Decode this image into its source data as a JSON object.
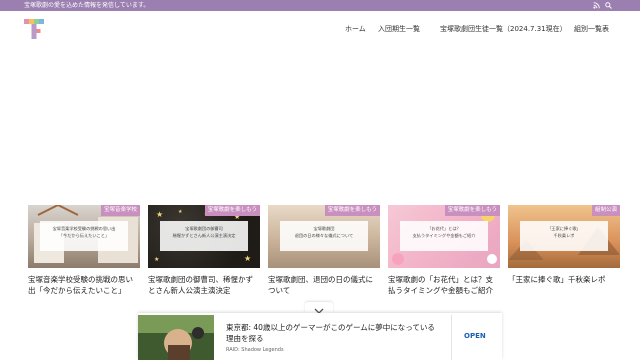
{
  "topbar": {
    "tagline": "宝塚歌劇の愛を込めた情報を発信しています。",
    "icons": [
      "rss-icon",
      "search-icon"
    ]
  },
  "header": {
    "nav": [
      {
        "label": "ホーム"
      },
      {
        "label": "入団期生一覧"
      },
      {
        "label": "宝塚歌劇団生徒一覧（2024.7.31現在）"
      },
      {
        "label": "組別一覧表"
      }
    ]
  },
  "cards": [
    {
      "badge": "宝塚音楽学校",
      "badge_color": "#c98fbf",
      "thumb_text": "宝塚音楽学校受験の挑戦の思い出\n「今だから伝えたいこと」",
      "title": "宝塚音楽学校受験の挑戦の思い出「今だから伝えたいこと」"
    },
    {
      "badge": "宝塚歌劇を楽しもう",
      "badge_color": "#c98fbf",
      "thumb_text": "宝塚歌劇団の御曹司\n稀惺かずとさん新人公演主演決定",
      "title": "宝塚歌劇団の御曹司、稀惺かずとさん新人公演主演決定"
    },
    {
      "badge": "宝塚歌劇を楽しもう",
      "badge_color": "#c98fbf",
      "thumb_text": "宝塚歌劇団\n退団の日の様々な儀式について",
      "title": "宝塚歌劇団、退団の日の儀式について"
    },
    {
      "badge": "宝塚歌劇を楽しもう",
      "badge_color": "#c98fbf",
      "thumb_text": "「お花代」とは？\n支払うタイミングや金額もご紹介",
      "title": "宝塚歌劇の「お花代」とは？支払うタイミングや金額もご紹介"
    },
    {
      "badge": "組制公演",
      "badge_color": "#c98fbf",
      "thumb_text": "「王家に捧ぐ歌」\n千秋楽レポ",
      "title": "「王家に捧ぐ歌」千秋楽レポ"
    }
  ],
  "bottom_ad": {
    "headline": "東京都: 40歳以上のゲーマーがこのゲームに夢中になっている理由を探る",
    "source": "RAID: Shadow Legends",
    "cta": "OPEN"
  },
  "colors": {
    "topbar": "#9a7fb0",
    "badge": "#c98fbf"
  }
}
